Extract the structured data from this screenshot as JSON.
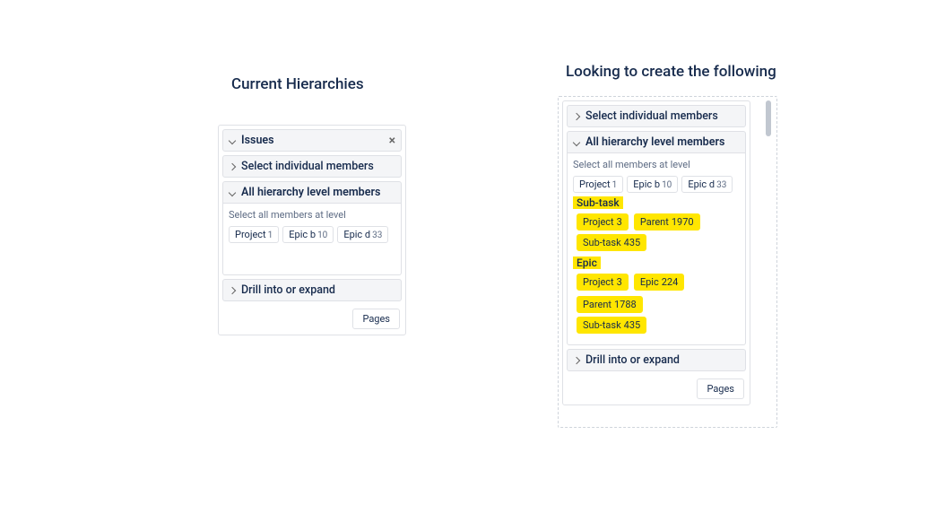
{
  "left": {
    "title": "Current Hierarchies",
    "panel_header": "Issues",
    "select_individual": "Select individual members",
    "all_level_header": "All hierarchy level members",
    "level_subtitle": "Select all members at level",
    "chips": [
      {
        "label": "Project",
        "count": "1"
      },
      {
        "label": "Epic b",
        "count": "10"
      },
      {
        "label": "Epic d",
        "count": "33"
      }
    ],
    "drill": "Drill into or expand",
    "pages": "Pages"
  },
  "right": {
    "title": "Looking to create the following",
    "select_individual": "Select individual members",
    "all_level_header": "All hierarchy level members",
    "level_subtitle": "Select all members at level",
    "chips": [
      {
        "label": "Project",
        "count": "1"
      },
      {
        "label": "Epic b",
        "count": "10"
      },
      {
        "label": "Epic d",
        "count": "33"
      }
    ],
    "group1": {
      "heading": "Sub-task",
      "chips": [
        {
          "label": "Project",
          "count": "3"
        },
        {
          "label": "Parent",
          "count": "1970"
        }
      ],
      "subrow": {
        "label": "Sub-task",
        "count": "435"
      }
    },
    "group2": {
      "heading": "Epic",
      "chips": [
        {
          "label": "Project",
          "count": "3"
        },
        {
          "label": "Epic",
          "count": "224"
        },
        {
          "label": "Parent",
          "count": "1788"
        }
      ],
      "subrow": {
        "label": "Sub-task",
        "count": "435"
      }
    },
    "drill": "Drill into or expand",
    "pages": "Pages"
  }
}
